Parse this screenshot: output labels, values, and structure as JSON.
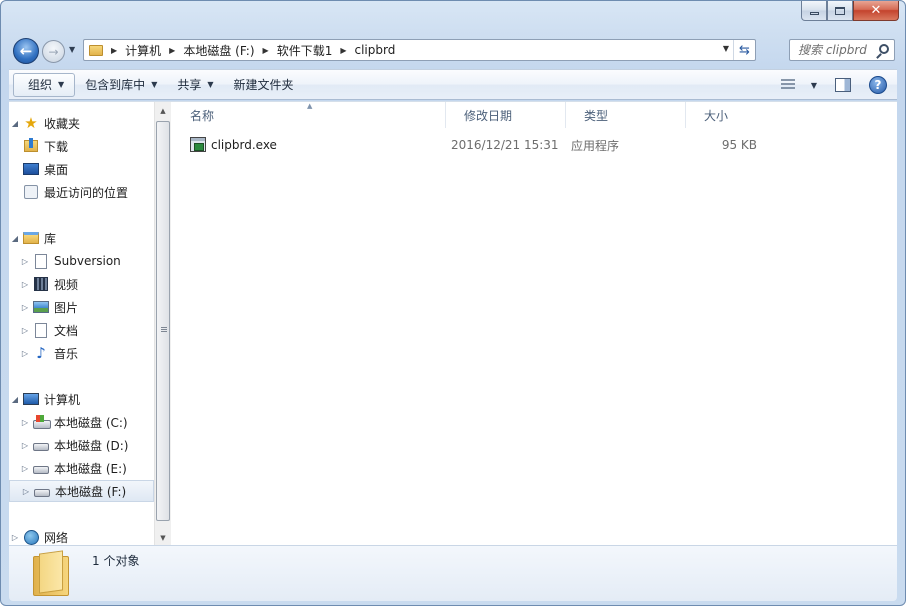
{
  "address": {
    "crumbs": [
      "计算机",
      "本地磁盘 (F:)",
      "软件下载1",
      "clipbrd"
    ]
  },
  "search": {
    "placeholder": "搜索 clipbrd"
  },
  "toolbar": {
    "organize": "组织",
    "include_library": "包含到库中",
    "share": "共享",
    "new_folder": "新建文件夹"
  },
  "nav": {
    "favorites": "收藏夹",
    "downloads": "下载",
    "desktop": "桌面",
    "recent": "最近访问的位置",
    "libraries": "库",
    "subversion": "Subversion",
    "videos": "视频",
    "pictures": "图片",
    "documents": "文档",
    "music": "音乐",
    "computer": "计算机",
    "drive_c": "本地磁盘 (C:)",
    "drive_d": "本地磁盘 (D:)",
    "drive_e": "本地磁盘 (E:)",
    "drive_f": "本地磁盘 (F:)",
    "network": "网络"
  },
  "columns": {
    "name": "名称",
    "date": "修改日期",
    "type": "类型",
    "size": "大小"
  },
  "files": [
    {
      "name": "clipbrd.exe",
      "date": "2016/12/21 15:31",
      "type": "应用程序",
      "size": "95 KB"
    }
  ],
  "details": {
    "count": "1 个对象"
  },
  "colors": {
    "selection": "#dfe8f3",
    "header_text": "#4c607a",
    "meta_text": "#6d6d6d"
  }
}
